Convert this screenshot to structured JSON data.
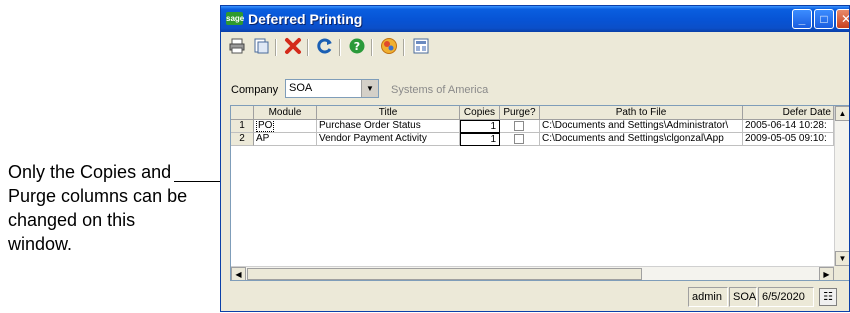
{
  "callout": {
    "text": "Only the Copies and Purge columns can be changed on this window."
  },
  "window": {
    "logo_text": "sage",
    "title": "Deferred Printing",
    "controls": {
      "minimize": "_",
      "maximize": "□",
      "close": "✕"
    }
  },
  "toolbar": {
    "icons": [
      "printer-icon",
      "print-preview-icon",
      "delete-icon",
      "refresh-icon",
      "help-icon",
      "web-icon",
      "settings-icon"
    ]
  },
  "company": {
    "label": "Company",
    "value": "SOA",
    "name": "Systems of America"
  },
  "grid": {
    "columns": [
      "Module",
      "Title",
      "Copies",
      "Purge?",
      "Path to File",
      "Defer Date"
    ],
    "rows": [
      {
        "num": "1",
        "module": "PO",
        "title": "Purchase Order Status",
        "copies": "1",
        "purge": false,
        "path": "C:\\Documents and Settings\\Administrator\\",
        "defer_date": "2005-06-14 10:28:"
      },
      {
        "num": "2",
        "module": "AP",
        "title": "Vendor Payment Activity",
        "copies": "1",
        "purge": false,
        "path": "C:\\Documents and Settings\\clgonzal\\App",
        "defer_date": "2009-05-05 09:10:"
      }
    ]
  },
  "statusbar": {
    "user": "admin",
    "company": "SOA",
    "date": "6/5/2020"
  },
  "colors": {
    "titlebar": "#0754d6",
    "window_bg": "#ece9d8",
    "close_button": "#c8401f",
    "sage_green": "#2f9a2f"
  }
}
